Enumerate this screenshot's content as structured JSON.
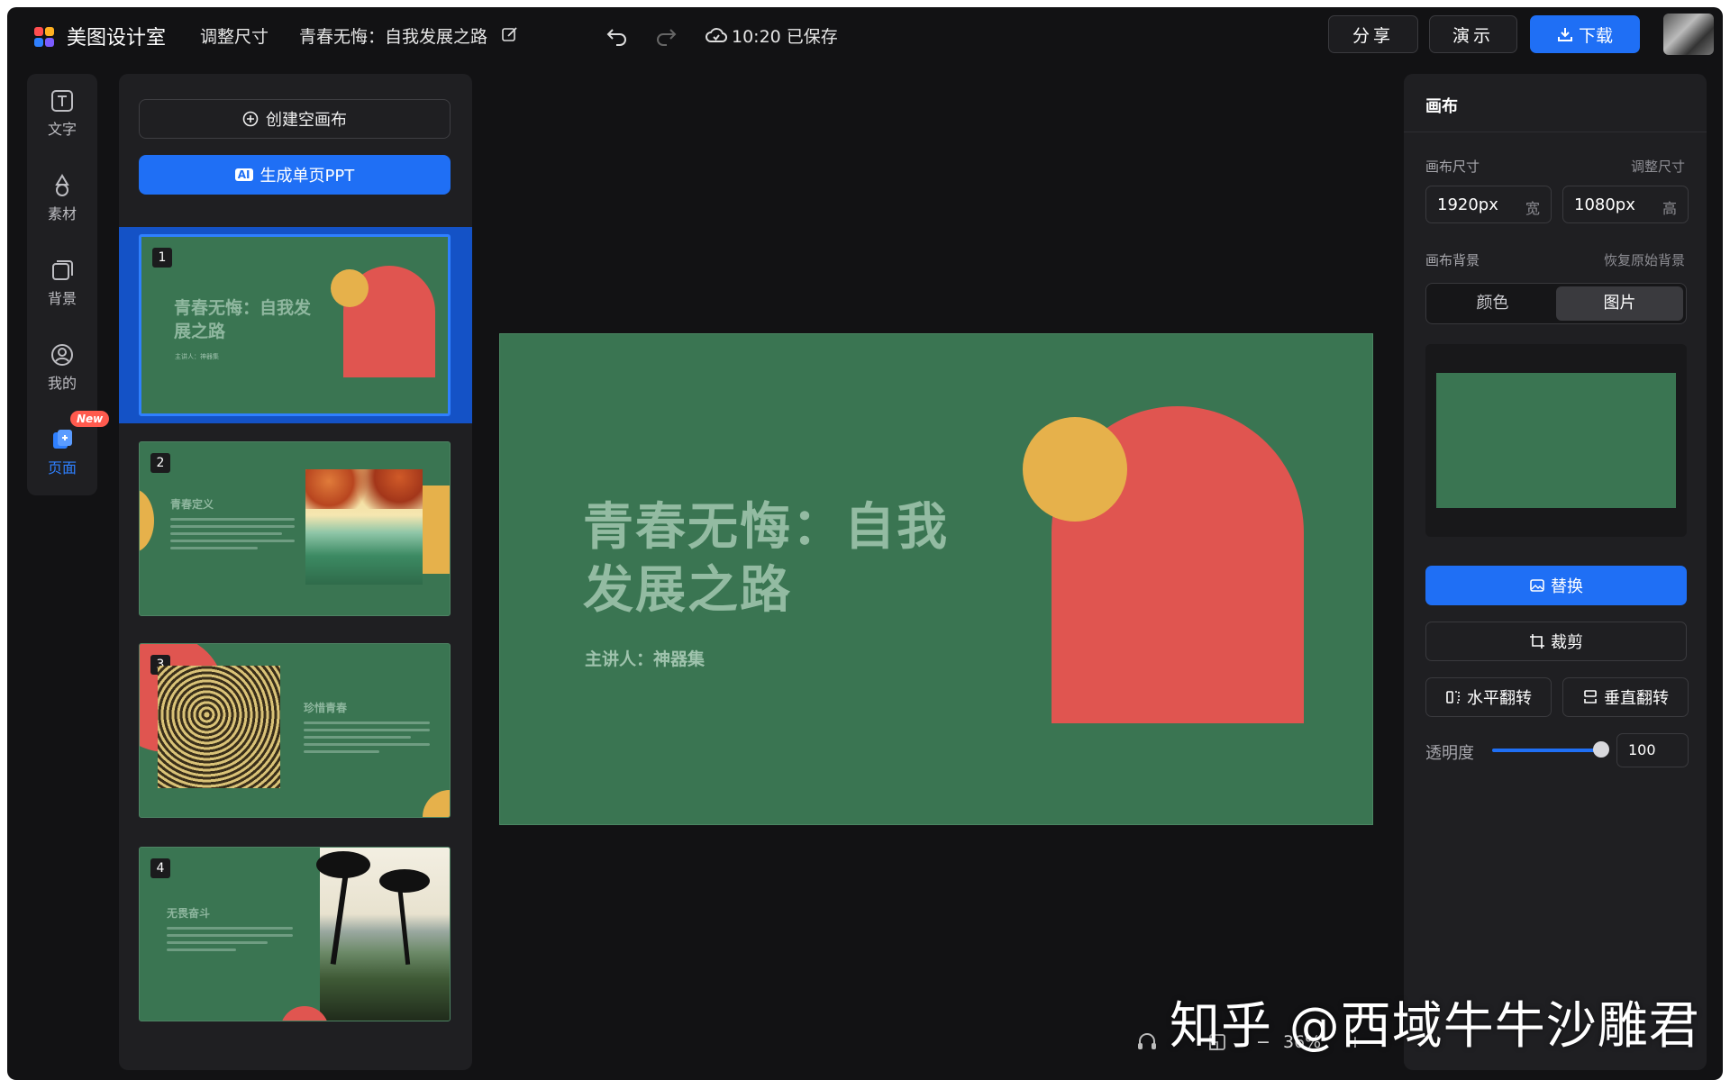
{
  "topbar": {
    "brand": "美图设计室",
    "resize_label": "调整尺寸",
    "doc_title": "青春无悔：自我发展之路",
    "save_status": "10:20 已保存",
    "share_label": "分享",
    "present_label": "演示",
    "download_label": "下载"
  },
  "rail": {
    "items": [
      {
        "label": "文字",
        "icon": "text-icon"
      },
      {
        "label": "素材",
        "icon": "shapes-icon"
      },
      {
        "label": "背景",
        "icon": "background-icon"
      },
      {
        "label": "我的",
        "icon": "user-icon"
      },
      {
        "label": "页面",
        "icon": "pages-icon"
      }
    ],
    "new_badge": "New"
  },
  "pages_panel": {
    "create_blank": "创建空画布",
    "ai_tag": "AI",
    "generate_ppt": "生成单页PPT",
    "thumbs": [
      {
        "num": "1",
        "title": "青春无悔：自我发展之路",
        "sub": "主讲人：神器集"
      },
      {
        "num": "2",
        "title": "青春定义"
      },
      {
        "num": "3",
        "title": "珍惜青春"
      },
      {
        "num": "4",
        "title": "无畏奋斗"
      }
    ]
  },
  "slide": {
    "title_line1": "青春无悔：自我",
    "title_line2": "发展之路",
    "subtitle": "主讲人：神器集",
    "colors": {
      "bg": "#3a7552",
      "arch": "#e05550",
      "circle": "#e6b14b"
    }
  },
  "bottom": {
    "zoom": "36%",
    "minus": "−",
    "plus": "+"
  },
  "props": {
    "header": "画布",
    "size_label": "画布尺寸",
    "resize_link": "调整尺寸",
    "width_value": "1920px",
    "width_unit": "宽",
    "height_value": "1080px",
    "height_unit": "高",
    "bg_label": "画布背景",
    "restore_link": "恢复原始背景",
    "seg_color": "颜色",
    "seg_image": "图片",
    "replace": "替换",
    "crop": "裁剪",
    "flip_h": "水平翻转",
    "flip_v": "垂直翻转",
    "opacity_label": "透明度",
    "opacity_value": "100"
  },
  "watermark": "知乎 @西域牛牛沙雕君"
}
